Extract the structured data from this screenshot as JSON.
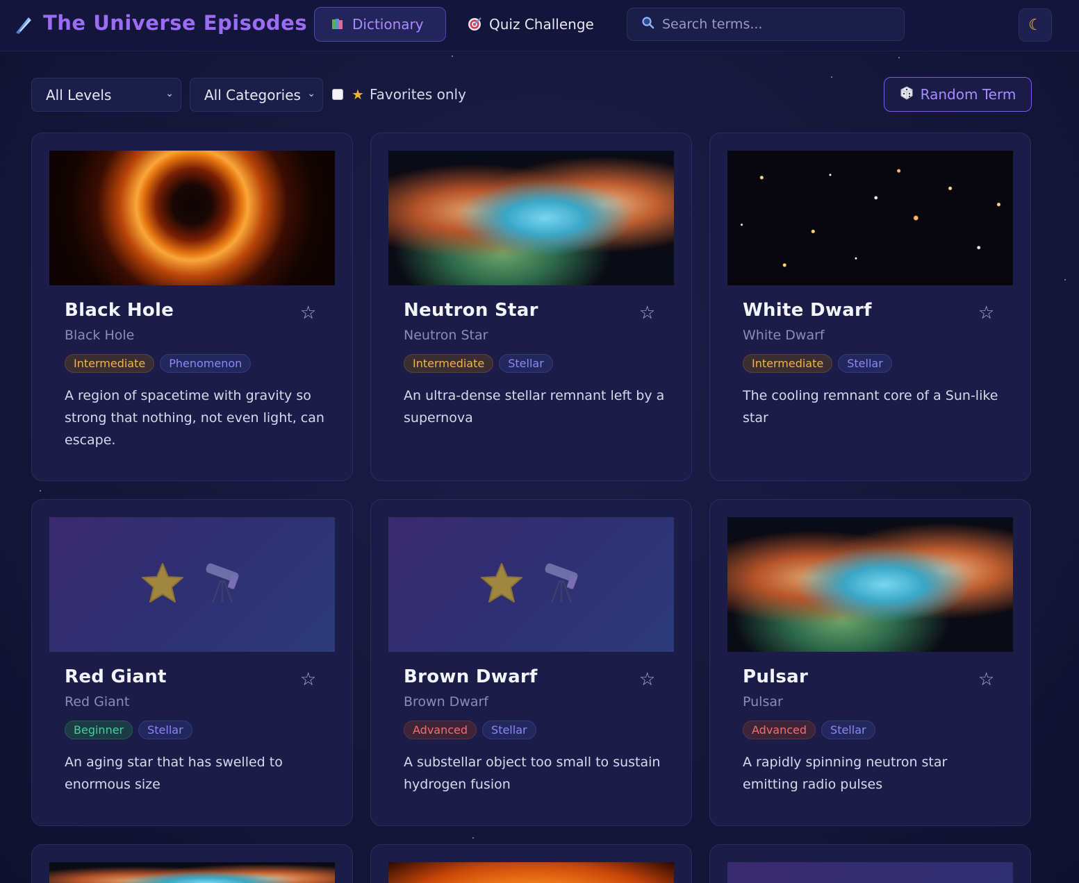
{
  "app": {
    "title": "The Universe Episodes",
    "logo_icon": "comet-icon"
  },
  "nav": {
    "dictionary_label": "Dictionary",
    "quiz_label": "Quiz Challenge",
    "active": "Dictionary"
  },
  "search": {
    "placeholder": "Search terms..."
  },
  "theme_toggle": {
    "icon": "moon-icon"
  },
  "filters": {
    "level_selected": "All Levels",
    "category_selected": "All Categories",
    "favorites_label": "Favorites only",
    "favorites_checked": false,
    "random_label": "Random Term"
  },
  "cards": [
    {
      "title": "Black Hole",
      "subtitle": "Black Hole",
      "level": "Intermediate",
      "category": "Phenomenon",
      "description": "A region of spacetime with gravity so strong that nothing, not even light, can escape."
    },
    {
      "title": "Neutron Star",
      "subtitle": "Neutron Star",
      "level": "Intermediate",
      "category": "Stellar",
      "description": "An ultra-dense stellar remnant left by a supernova"
    },
    {
      "title": "White Dwarf",
      "subtitle": "White Dwarf",
      "level": "Intermediate",
      "category": "Stellar",
      "description": "The cooling remnant core of a Sun-like star"
    },
    {
      "title": "Red Giant",
      "subtitle": "Red Giant",
      "level": "Beginner",
      "category": "Stellar",
      "description": "An aging star that has swelled to enormous size"
    },
    {
      "title": "Brown Dwarf",
      "subtitle": "Brown Dwarf",
      "level": "Advanced",
      "category": "Stellar",
      "description": "A substellar object too small to sustain hydrogen fusion"
    },
    {
      "title": "Pulsar",
      "subtitle": "Pulsar",
      "level": "Advanced",
      "category": "Stellar",
      "description": "A rapidly spinning neutron star emitting radio pulses"
    }
  ],
  "colors": {
    "accent": "#9b6cf5",
    "intermediate": "#f0b34a",
    "beginner": "#3fd49a",
    "advanced": "#f2706b",
    "category": "#8d88f5"
  }
}
